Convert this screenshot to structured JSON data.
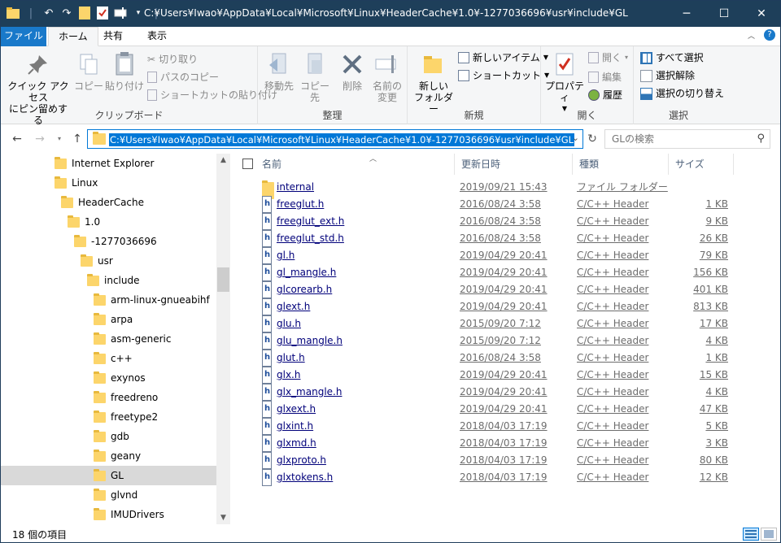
{
  "window": {
    "title": "C:¥Users¥Iwao¥AppData¥Local¥Microsoft¥Linux¥HeaderCache¥1.0¥-1277036696¥usr¥include¥GL",
    "controls": {
      "minimize": "─",
      "maximize": "☐",
      "close": "✕"
    }
  },
  "ribbon": {
    "tabs": [
      {
        "label": "ファイル"
      },
      {
        "label": "ホーム"
      },
      {
        "label": "共有"
      },
      {
        "label": "表示"
      }
    ],
    "help_icon": "?",
    "groups": {
      "clipboard": {
        "label": "クリップボード",
        "pin": "クイック アクセス\nにピン留めする",
        "copy": "コピー",
        "paste": "貼り付け",
        "cut": "切り取り",
        "copy_path": "パスのコピー",
        "paste_shortcut": "ショートカットの貼り付け"
      },
      "organize": {
        "label": "整理",
        "move_to": "移動先",
        "copy_to": "コピー先",
        "delete": "削除",
        "rename": "名前の\n変更"
      },
      "new": {
        "label": "新規",
        "new_folder": "新しい\nフォルダー",
        "new_item": "新しいアイテム",
        "easy_access": "ショートカット"
      },
      "open": {
        "label": "開く",
        "properties": "プロパティ",
        "open": "開く",
        "edit": "編集",
        "history": "履歴"
      },
      "select": {
        "label": "選択",
        "select_all": "すべて選択",
        "select_none": "選択解除",
        "invert": "選択の切り替え"
      }
    }
  },
  "address": {
    "path": "C:¥Users¥Iwao¥AppData¥Local¥Microsoft¥Linux¥HeaderCache¥1.0¥-1277036696¥usr¥include¥GL",
    "search_placeholder": "GLの検索"
  },
  "nav_tree": [
    {
      "label": "Internet Explorer",
      "indent": 0
    },
    {
      "label": "Linux",
      "indent": 0
    },
    {
      "label": "HeaderCache",
      "indent": 1
    },
    {
      "label": "1.0",
      "indent": 2
    },
    {
      "label": "-1277036696",
      "indent": 3
    },
    {
      "label": "usr",
      "indent": 4
    },
    {
      "label": "include",
      "indent": 5
    },
    {
      "label": "arm-linux-gnueabihf",
      "indent": 6
    },
    {
      "label": "arpa",
      "indent": 6
    },
    {
      "label": "asm-generic",
      "indent": 6
    },
    {
      "label": "c++",
      "indent": 6
    },
    {
      "label": "exynos",
      "indent": 6
    },
    {
      "label": "freedreno",
      "indent": 6
    },
    {
      "label": "freetype2",
      "indent": 6
    },
    {
      "label": "gdb",
      "indent": 6
    },
    {
      "label": "geany",
      "indent": 6
    },
    {
      "label": "GL",
      "indent": 6,
      "selected": true
    },
    {
      "label": "glvnd",
      "indent": 6
    },
    {
      "label": "IMUDrivers",
      "indent": 6
    }
  ],
  "columns": {
    "name": "名前",
    "date": "更新日時",
    "type": "種類",
    "size": "サイズ"
  },
  "files": [
    {
      "name": "internal",
      "date": "2019/09/21 15:43",
      "type": "ファイル フォルダー",
      "size": "",
      "folder": true
    },
    {
      "name": "freeglut.h",
      "date": "2016/08/24 3:58",
      "type": "C/C++ Header",
      "size": "1 KB"
    },
    {
      "name": "freeglut_ext.h",
      "date": "2016/08/24 3:58",
      "type": "C/C++ Header",
      "size": "9 KB"
    },
    {
      "name": "freeglut_std.h",
      "date": "2016/08/24 3:58",
      "type": "C/C++ Header",
      "size": "26 KB"
    },
    {
      "name": "gl.h",
      "date": "2019/04/29 20:41",
      "type": "C/C++ Header",
      "size": "79 KB"
    },
    {
      "name": "gl_mangle.h",
      "date": "2019/04/29 20:41",
      "type": "C/C++ Header",
      "size": "156 KB"
    },
    {
      "name": "glcorearb.h",
      "date": "2019/04/29 20:41",
      "type": "C/C++ Header",
      "size": "401 KB"
    },
    {
      "name": "glext.h",
      "date": "2019/04/29 20:41",
      "type": "C/C++ Header",
      "size": "813 KB"
    },
    {
      "name": "glu.h",
      "date": "2015/09/20 7:12",
      "type": "C/C++ Header",
      "size": "17 KB"
    },
    {
      "name": "glu_mangle.h",
      "date": "2015/09/20 7:12",
      "type": "C/C++ Header",
      "size": "4 KB"
    },
    {
      "name": "glut.h",
      "date": "2016/08/24 3:58",
      "type": "C/C++ Header",
      "size": "1 KB"
    },
    {
      "name": "glx.h",
      "date": "2019/04/29 20:41",
      "type": "C/C++ Header",
      "size": "15 KB"
    },
    {
      "name": "glx_mangle.h",
      "date": "2019/04/29 20:41",
      "type": "C/C++ Header",
      "size": "4 KB"
    },
    {
      "name": "glxext.h",
      "date": "2019/04/29 20:41",
      "type": "C/C++ Header",
      "size": "47 KB"
    },
    {
      "name": "glxint.h",
      "date": "2018/04/03 17:19",
      "type": "C/C++ Header",
      "size": "5 KB"
    },
    {
      "name": "glxmd.h",
      "date": "2018/04/03 17:19",
      "type": "C/C++ Header",
      "size": "3 KB"
    },
    {
      "name": "glxproto.h",
      "date": "2018/04/03 17:19",
      "type": "C/C++ Header",
      "size": "80 KB"
    },
    {
      "name": "glxtokens.h",
      "date": "2018/04/03 17:19",
      "type": "C/C++ Header",
      "size": "12 KB"
    }
  ],
  "status": {
    "count": "18 個の項目"
  }
}
